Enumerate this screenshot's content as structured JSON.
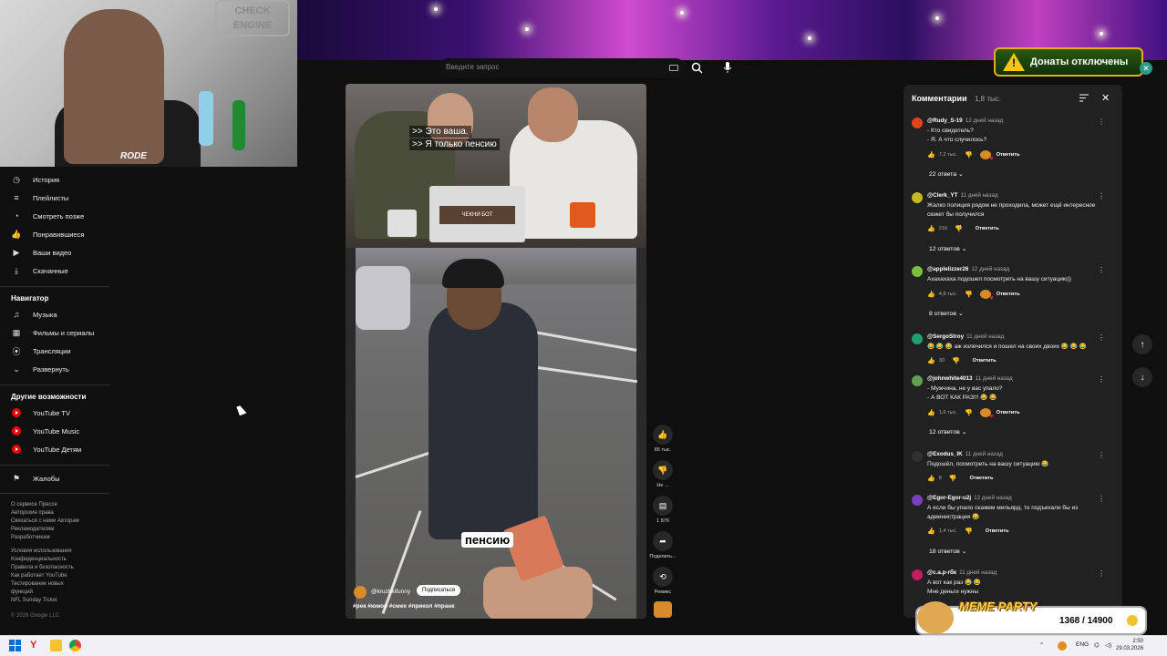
{
  "search": {
    "placeholder": "Введите запрос"
  },
  "webcam": {
    "sign_text": "CHECK ENGINE",
    "mic_brand": "RODE"
  },
  "sidebar": {
    "library_items": [
      {
        "label": "История",
        "icon": "history-icon"
      },
      {
        "label": "Плейлисты",
        "icon": "playlist-icon"
      },
      {
        "label": "Смотреть позже",
        "icon": "watch-later-icon"
      },
      {
        "label": "Понравившиеся",
        "icon": "thumb-up-icon"
      },
      {
        "label": "Ваши видео",
        "icon": "your-videos-icon"
      },
      {
        "label": "Скачанные",
        "icon": "download-icon"
      }
    ],
    "navigator_title": "Навигатор",
    "navigator_items": [
      {
        "label": "Музыка",
        "icon": "music-icon"
      },
      {
        "label": "Фильмы и сериалы",
        "icon": "film-icon"
      },
      {
        "label": "Трансляции",
        "icon": "live-icon"
      },
      {
        "label": "Развернуть",
        "icon": "chevron-down-icon"
      }
    ],
    "other_title": "Другие возможности",
    "other_items": [
      {
        "label": "YouTube TV"
      },
      {
        "label": "YouTube Music"
      },
      {
        "label": "YouTube Детям"
      }
    ],
    "report_label": "Жалобы",
    "footer_1": [
      "О сервисе  Прессе",
      "Авторские права",
      "Связаться с нами  Авторам",
      "Рекламодателям",
      "Разработчикам"
    ],
    "footer_2": [
      "Условия использования",
      "Конфиденциальность",
      "Правила и безопасность",
      "Как работает YouTube",
      "Тестирование новых",
      "функций",
      "NFL Sunday Ticket"
    ],
    "copyright": "© 2026 Google LLC"
  },
  "video": {
    "subtitle_1": ">> Это ваша.",
    "subtitle_2": ">> Я только пенсию",
    "caption": "пенсию",
    "channel": "@kruzhkifunny",
    "subscribe_label": "Подписаться",
    "tags": "#рек #юмор #смех #прикол #пранк",
    "monitor_text": "ЧЕКНИ БОТ"
  },
  "actions": {
    "likes": "85 тыс.",
    "dislike": "Не ...",
    "comments": "1 876",
    "share": "Поделить...",
    "remix": "Ремикс"
  },
  "comments": {
    "title": "Комментарии",
    "count": "1,8 тыс.",
    "reply_label": "Ответить",
    "items": [
      {
        "author": "@Rudy_S-19",
        "time": "12 дней назад",
        "text": "- Кто свидетель?\n- Я. А что случилось?",
        "likes": "7,2 тыс.",
        "replies": "22 ответа",
        "color": "#e0451c",
        "hearted": true
      },
      {
        "author": "@Clerk_YT",
        "time": "11 дней назад",
        "text": "Жалко полиция рядом не проходила, может ещё интересное сюжет бы получился",
        "likes": "216",
        "replies": "12 ответов",
        "color": "#c8b820",
        "hearted": false
      },
      {
        "author": "@applelizzer26",
        "time": "12 дней назад",
        "text": "Ахахахаха подошел посмотреть на вашу ситуацию))",
        "likes": "4,8 тыс.",
        "replies": "8 ответов",
        "color": "#7ac040",
        "hearted": true
      },
      {
        "author": "@SergoStroy",
        "time": "11 дней назад",
        "text": "😂 😂 😂 аж излечился и пошел на своих двоих 😂 😂 😂",
        "likes": "30",
        "replies": "",
        "color": "#20a070",
        "hearted": false
      },
      {
        "author": "@johnwhite4013",
        "time": "11 дней назад",
        "text": "- Мужчина, не у вас упало?\n- А ВОТ КАК РАЗ!!! 😂 😂",
        "likes": "1,6 тыс.",
        "replies": "12 ответов",
        "color": "#60a050",
        "hearted": true
      },
      {
        "author": "@Exodus_IK",
        "time": "11 дней назад",
        "text": "Подошёл, посмотреть на вашу ситуацию 😂",
        "likes": "8",
        "replies": "",
        "color": "#303030",
        "hearted": false
      },
      {
        "author": "@Egor-Egor-u2j",
        "time": "12 дней назад",
        "text": "А если бы упало скажем мильярд, то подъехали бы из администрации 😂",
        "likes": "1,4 тыс.",
        "replies": "18 ответов",
        "color": "#7a40c0",
        "hearted": false
      },
      {
        "author": "@c.a.p-rбк",
        "time": "11 дней назад",
        "text": "А вот как раз 😂 😂\nМне деньги нужны",
        "likes": "",
        "replies": "",
        "color": "#c02060",
        "hearted": false
      }
    ]
  },
  "overlays": {
    "donations_text": "Донаты отключены",
    "meme_title": "MEME PARTY",
    "meme_progress": "1368 / 14900"
  },
  "taskbar": {
    "lang": "ENG",
    "time": "2:50",
    "date": "29.03.2026"
  },
  "colors": {
    "accent_red": "#ff0000",
    "background": "#0f0f0f",
    "panel": "#212121"
  }
}
